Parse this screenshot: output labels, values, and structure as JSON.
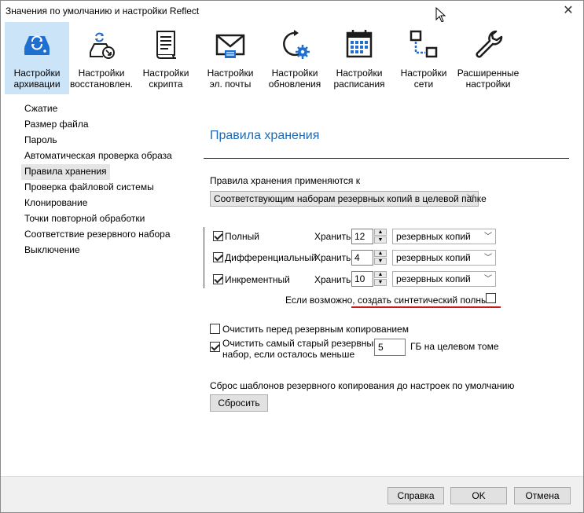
{
  "window": {
    "title": "Значения по умолчанию и настройки Reflect"
  },
  "toolbar": {
    "items": [
      {
        "line1": "Настройки",
        "line2": "архивации",
        "icon": "backup-drive-icon"
      },
      {
        "line1": "Настройки",
        "line2": "восстановлен.",
        "icon": "restore-icon"
      },
      {
        "line1": "Настройки",
        "line2": "скрипта",
        "icon": "script-icon"
      },
      {
        "line1": "Настройки",
        "line2": "эл. почты",
        "icon": "mail-icon"
      },
      {
        "line1": "Настройки",
        "line2": "обновления",
        "icon": "update-gear-icon"
      },
      {
        "line1": "Настройки",
        "line2": "расписания",
        "icon": "calendar-icon"
      },
      {
        "line1": "Настройки",
        "line2": "сети",
        "icon": "network-icon"
      },
      {
        "line1": "Расширенные",
        "line2": "настройки",
        "icon": "wrench-icon"
      }
    ]
  },
  "sidebar": {
    "items": [
      "Сжатие",
      "Размер файла",
      "Пароль",
      "Автоматическая проверка образа",
      "Правила хранения",
      "Проверка файловой системы",
      "Клонирование",
      "Точки повторной обработки",
      "Соответствие резервного набора",
      "Выключение"
    ],
    "selected_index": 4
  },
  "main": {
    "title": "Правила хранения",
    "applies_label": "Правила хранения применяются к",
    "applies_value": "Соответствующим наборам резервных копий в целевой папке",
    "rows": [
      {
        "label": "Полный",
        "keep_label": "Хранить",
        "count": "12",
        "unit": "резервных копий",
        "checked": true
      },
      {
        "label": "Дифференциальный",
        "keep_label": "Хранить",
        "count": "4",
        "unit": "резервных копий",
        "checked": true
      },
      {
        "label": "Инкрементный",
        "keep_label": "Хранить",
        "count": "10",
        "unit": "резервных копий",
        "checked": true
      }
    ],
    "synthetic_label": "Если возможно, создать синтетический полный",
    "purge_before_label": "Очистить перед резервным копированием",
    "purge_oldest_line1": "Очистить самый старый резервный",
    "purge_oldest_line2": "набор, если осталось меньше",
    "purge_oldest_value": "5",
    "purge_oldest_unit": "ГБ на целевом томе",
    "reset_label": "Сброс шаблонов резервного копирования до настроек по умолчанию",
    "reset_button": "Сбросить"
  },
  "footer": {
    "help": "Справка",
    "ok": "OK",
    "cancel": "Отмена"
  },
  "colors": {
    "accent": "#1f6ab5",
    "active_tab": "#cce4f7",
    "annotation_red": "#c9191f",
    "icon_dark": "#1c1c1c",
    "icon_blue": "#1e6fd0"
  }
}
